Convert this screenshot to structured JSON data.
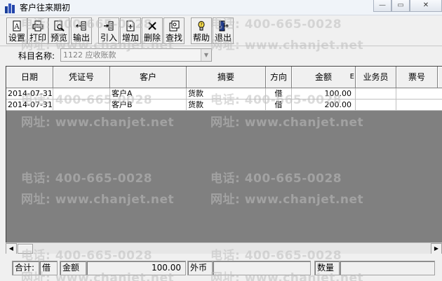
{
  "window": {
    "title": "客户往来期初",
    "minimize_symbol": "—",
    "maximize_symbol": "▭",
    "close_symbol": "✕"
  },
  "toolbar": {
    "buttons": [
      {
        "label": "设置",
        "icon": "settings-icon"
      },
      {
        "label": "打印",
        "icon": "printer-icon"
      },
      {
        "label": "预览",
        "icon": "preview-icon"
      },
      {
        "label": "输出",
        "icon": "export-icon"
      },
      {
        "label": "引入",
        "icon": "import-icon"
      },
      {
        "label": "增加",
        "icon": "add-icon"
      },
      {
        "label": "删除",
        "icon": "delete-icon"
      },
      {
        "label": "查找",
        "icon": "find-icon"
      },
      {
        "label": "帮助",
        "icon": "help-icon"
      },
      {
        "label": "退出",
        "icon": "exit-icon"
      }
    ]
  },
  "subject": {
    "label": "科目名称:",
    "value": "1122 应收账款"
  },
  "grid": {
    "columns": [
      "日期",
      "凭证号",
      "客户",
      "摘要",
      "方向",
      "金额",
      "业务员",
      "票号"
    ],
    "amount_header_suffix": "E",
    "rows": [
      {
        "date": "2014-07-31",
        "voucher": "",
        "customer": "客户A",
        "summary": "货款",
        "direction": "借",
        "amount": "100.00",
        "salesperson": "",
        "ticket": ""
      },
      {
        "date": "2014-07-31",
        "voucher": "",
        "customer": "客户B",
        "summary": "货款",
        "direction": "借",
        "amount": "200.00",
        "salesperson": "",
        "ticket": ""
      }
    ]
  },
  "scrollbar": {
    "left_arrow": "◀",
    "right_arrow": "▶"
  },
  "footer": {
    "total_label": "合计:",
    "direction": "借",
    "amount_label": "金额",
    "amount_value": "100.00",
    "foreign_label": "外币",
    "foreign_value": "",
    "quantity_label": "数量",
    "quantity_value": ""
  },
  "watermark": {
    "phone": "电话: 400-665-0028",
    "site": "网址: www.chanjet.net"
  }
}
